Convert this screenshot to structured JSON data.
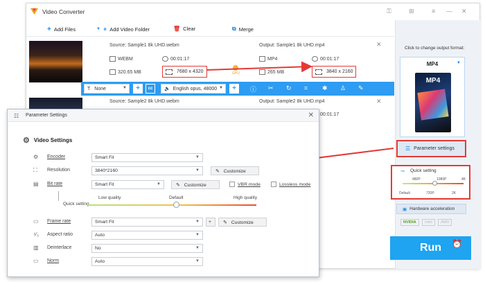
{
  "window": {
    "title": "Video Converter",
    "controls": [
      "key",
      "cart",
      "menu",
      "minimize",
      "close"
    ]
  },
  "toolbar": {
    "add_files": "Add Files",
    "add_video_folder": "Add Video Folder",
    "clear": "Clear",
    "merge": "Merge"
  },
  "files": [
    {
      "source": "Source: Sample1 8k UHD.webm",
      "output": "Output: Sample1 8k UHD.mp4",
      "src_format": "WEBM",
      "src_duration": "00:01:17",
      "src_size": "320.65 MB",
      "src_resolution": "7680 x 4320",
      "out_format": "MP4",
      "out_duration": "00:01:17",
      "out_size": "265 MB",
      "out_resolution": "3840 x 2160",
      "gpu_label": "GPU"
    },
    {
      "source": "Source: Sample2 8k UHD.webm",
      "output": "Output: Sample2 8k UHD.mp4",
      "out_duration": "00:01:17"
    }
  ],
  "file_bar": {
    "subtitle": "None",
    "audio": "English opus, 48000"
  },
  "right_panel": {
    "hint": "Click to change output format:",
    "format": "MP4",
    "format_tile_label": "MP4",
    "parameter_settings": "Parameter settings",
    "quick_setting": "Quick setting",
    "scale_top": [
      "480P",
      "1080P",
      "4K"
    ],
    "scale_bottom": [
      "Default",
      "720P",
      "2K"
    ],
    "hardware_acceleration": "Hardware acceleration",
    "gpus": [
      "NVIDIA",
      "Intel",
      "AMD"
    ],
    "run": "Run"
  },
  "dialog": {
    "title": "Parameter Settings",
    "section": "Video Settings",
    "rows": {
      "encoder": {
        "label": "Encoder",
        "value": "Smart Fit"
      },
      "resolution": {
        "label": "Resolution",
        "value": "3840*2160",
        "customize": "Customize"
      },
      "bitrate": {
        "label": "Bit rate",
        "value": "Smart Fit",
        "customize": "Customize",
        "vbr": "VBR mode",
        "lossless": "Lossless mode"
      },
      "quick": {
        "label": "Quick setting",
        "low": "Low quality",
        "default": "Default",
        "high": "High quality"
      },
      "framerate": {
        "label": "Frame rate",
        "value": "Smart Fit",
        "customize": "Customize"
      },
      "aspect": {
        "label": "Aspect ratio",
        "value": "Auto"
      },
      "deinterlace": {
        "label": "Deinterlace",
        "value": "No"
      },
      "norm": {
        "label": "Norm",
        "value": "Auto"
      }
    }
  },
  "colors": {
    "accent_blue": "#2d9cf2",
    "run_blue": "#1ea4f0",
    "highlight_red": "#e53935"
  }
}
